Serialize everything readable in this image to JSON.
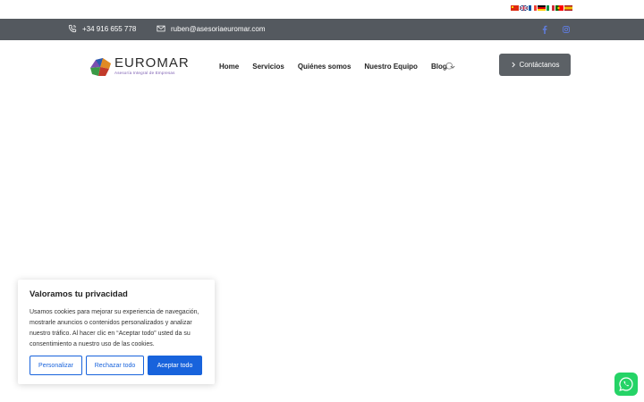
{
  "language_flags": [
    {
      "name": "chinese-flag",
      "colors": [
        "#de2910",
        "#de2910",
        "#de2910"
      ]
    },
    {
      "name": "english-flag",
      "colors": [
        "#012169",
        "#ffffff",
        "#c8102e"
      ]
    },
    {
      "name": "french-flag",
      "colors": [
        "#0055a4",
        "#ffffff",
        "#ef4135"
      ]
    },
    {
      "name": "german-flag",
      "colors": [
        "#000000",
        "#dd0000",
        "#ffce00"
      ]
    },
    {
      "name": "italian-flag",
      "colors": [
        "#009246",
        "#ffffff",
        "#ce2b37"
      ]
    },
    {
      "name": "portuguese-flag",
      "colors": [
        "#006600",
        "#ff0000",
        "#ff0000"
      ]
    },
    {
      "name": "spanish-flag",
      "colors": [
        "#aa151b",
        "#f1bf00",
        "#aa151b"
      ]
    }
  ],
  "topbar": {
    "phone": "+34 916 655 778",
    "email": "ruben@asesoriaeuromar.com",
    "phone_icon": "phone-icon",
    "email_icon": "envelope-icon",
    "social": [
      "facebook-icon",
      "instagram-icon"
    ],
    "accent": "#5f7bd8"
  },
  "logo": {
    "name": "EUROMAR",
    "tagline": "Asesoría Integral de Empresas"
  },
  "nav": {
    "items": [
      "Home",
      "Servicios",
      "Quiénes somos",
      "Nuestro Equipo",
      "Blog"
    ]
  },
  "cta": {
    "label": "Contáctanos"
  },
  "cookie": {
    "title": "Valoramos tu privacidad",
    "text": "Usamos cookies para mejorar su experiencia de navegación, mostrarle anuncios o contenidos personalizados y analizar nuestro tráfico. Al hacer clic en “Aceptar todo” usted da su consentimiento a nuestro uso de las cookies.",
    "buttons": {
      "customize": "Personalizar",
      "reject": "Rechazar todo",
      "accept": "Aceptar todo"
    },
    "accent": "#1863dc"
  },
  "whatsapp": {
    "icon": "whatsapp-icon",
    "color": "#25d366"
  }
}
